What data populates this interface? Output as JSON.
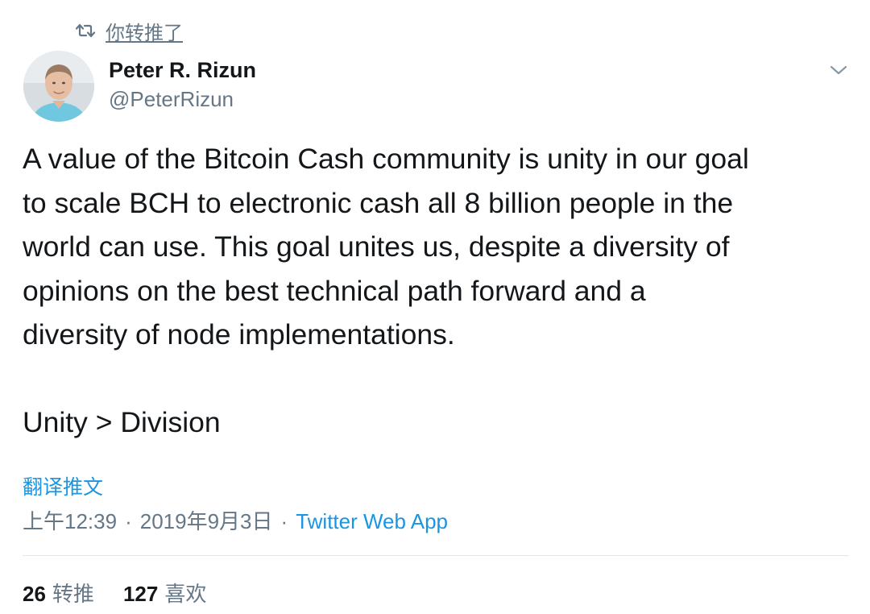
{
  "retweet_indicator": {
    "icon": "retweet-icon",
    "text": "你转推了"
  },
  "author": {
    "name": "Peter R. Rizun",
    "handle": "@PeterRizun"
  },
  "tweet": {
    "text": "A value of the Bitcoin Cash community is unity in our goal\nto scale BCH to electronic cash all 8 billion people in the\nworld can use. This goal unites us, despite a diversity of\nopinions on the best technical path forward and a\ndiversity of node implementations.\n\nUnity > Division"
  },
  "translate_label": "翻译推文",
  "meta": {
    "time": "上午12:39",
    "separator": "·",
    "date": "2019年9月3日",
    "source": "Twitter Web App"
  },
  "stats": {
    "retweets_count": "26",
    "retweets_label": "转推",
    "likes_count": "127",
    "likes_label": "喜欢"
  },
  "colors": {
    "text": "#14171a",
    "secondary": "#657786",
    "link": "#1b95e0",
    "divider": "#e1e8ed"
  }
}
